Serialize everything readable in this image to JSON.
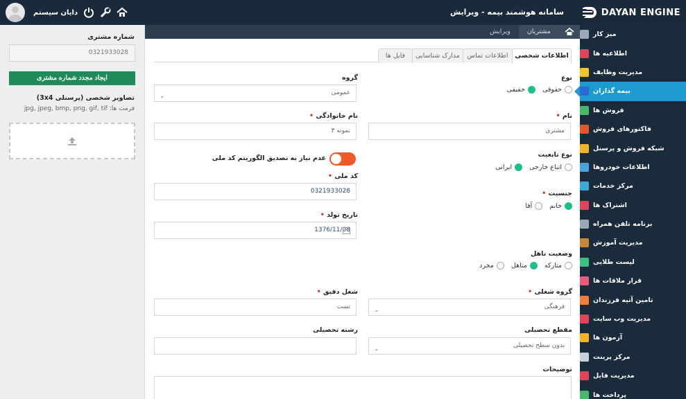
{
  "app": {
    "brand": "DAYAN ENGINE",
    "title": "سامانه هوشمند بیمه - ویرایش",
    "user_name": "دایان سیستم",
    "colors": {
      "topbar": "#1a2a3b",
      "sidebar": "#1a2b3c",
      "accent": "#1d9ad0",
      "green": "#1f8a5a",
      "toggle": "#f05a28",
      "radio_on": "#1fbe8b"
    }
  },
  "breadcrumb": [
    "مشتریان",
    "ویرایش"
  ],
  "left_panel": {
    "customer_number_label": "شماره مشتری",
    "customer_number_value": "0321933028",
    "regenerate_button": "ایجاد مجدد شماره مشتری",
    "photo_label": "تصاویر شخصی (پرسنلی 3x4)",
    "formats_hint": "فرمت ها: jpg, jpeg, bmp, png, gif, tif"
  },
  "tabs": [
    "اطلاعات شخصی",
    "اطلاعات تماس",
    "مدارک شناسایی",
    "فایل ها"
  ],
  "form": {
    "type_label": "نوع",
    "type_options": [
      "حقیقی",
      "حقوقی"
    ],
    "group_label": "گروه",
    "group_value": "عمومی",
    "name_label": "نام",
    "name_value": "مشتری",
    "family_label": "نام خانوادگی",
    "family_value": "نمونه ۳",
    "nationality_label": "نوع تابعیت",
    "nationality_options": [
      "ایرانی",
      "اتباع خارجی"
    ],
    "national_code_toggle_label": "عدم نیاز به تصدیق الگوریتم کد ملی",
    "national_code_label": "کد ملی",
    "national_code_value": "0321933028",
    "gender_label": "جنسیت",
    "gender_options": [
      "آقا",
      "خانم"
    ],
    "birth_label": "تاریخ تولد",
    "birth_value": "1376/11/08",
    "marital_label": "وضعیت تاهل",
    "marital_options": [
      "مجرد",
      "متاهل",
      "متارکه"
    ],
    "job_group_label": "گروه شغلی",
    "job_group_value": "فرهنگی",
    "exact_job_label": "شغل دقیق",
    "exact_job_value": "تست",
    "education_label": "مقطع تحصیلی",
    "education_value": "بدون سطح تحصیلی",
    "field_label": "رشته تحصیلی",
    "field_value": "",
    "notes_label": "توضیحات"
  },
  "sidebar": [
    {
      "label": "میز کار",
      "icon": "dashboard-icon",
      "color": "#9aa8b8"
    },
    {
      "label": "اطلاعیه ها",
      "icon": "megaphone-icon",
      "color": "#e0445a"
    },
    {
      "label": "مدیریت وظایف",
      "icon": "notepad-icon",
      "color": "#f1c232"
    },
    {
      "label": "بیمه گذاران",
      "icon": "users-icon",
      "color": "#2a6ad1"
    },
    {
      "label": "فروش ها",
      "icon": "money-icon",
      "color": "#49b86b"
    },
    {
      "label": "فاکتورهای فروش",
      "icon": "invoice-icon",
      "color": "#e8542f"
    },
    {
      "label": "شبکه فروش و پرسنل",
      "icon": "network-icon",
      "color": "#f0b429"
    },
    {
      "label": "اطلاعات خودروها",
      "icon": "car-icon",
      "color": "#4aa3df"
    },
    {
      "label": "مرکز خدمات",
      "icon": "service-icon",
      "color": "#3fa7d6"
    },
    {
      "label": "اشتراک ها",
      "icon": "share-icon",
      "color": "#e0445a"
    },
    {
      "label": "برنامه تلفن همراه",
      "icon": "mobile-icon",
      "color": "#9aa8b8"
    },
    {
      "label": "مدیریت آموزش",
      "icon": "book-icon",
      "color": "#c9863a"
    },
    {
      "label": "لیست طلایی",
      "icon": "gold-list-icon",
      "color": "#3fbf7f"
    },
    {
      "label": "قرار ملاقات ها",
      "icon": "calendar-icon",
      "color": "#e85d75"
    },
    {
      "label": "تامین آتیه فرزندان",
      "icon": "child-icon",
      "color": "#f07c3e"
    },
    {
      "label": "مدیریت وب سایت",
      "icon": "website-icon",
      "color": "#e0445a"
    },
    {
      "label": "آزمون ها",
      "icon": "pencil-icon",
      "color": "#f0b429"
    },
    {
      "label": "مرکز پرینت",
      "icon": "printer-icon",
      "color": "#c8d0d8"
    },
    {
      "label": "مدیریت فایل",
      "icon": "folder-icon",
      "color": "#e0445a"
    },
    {
      "label": "پرداخت ها",
      "icon": "payment-icon",
      "color": "#49b86b"
    }
  ]
}
